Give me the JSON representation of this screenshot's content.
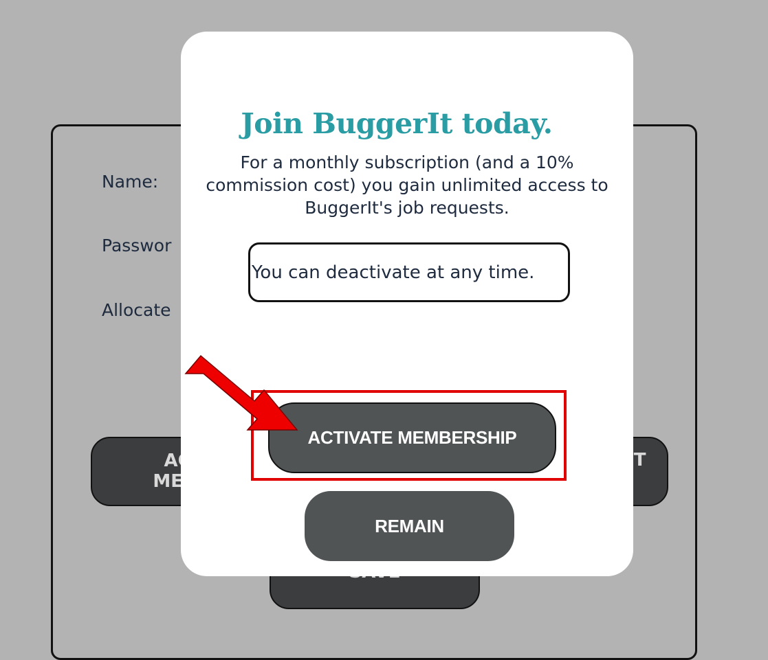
{
  "background": {
    "fields": {
      "name_label": "Name:",
      "password_label": "Passwor",
      "allocated_label": "Allocate"
    },
    "buttons": {
      "left_line1": "ACT",
      "left_line2": "MEMI",
      "right_fragment": "NT",
      "save_fragment": "SAVE"
    }
  },
  "modal": {
    "title": "Join BuggerIt today.",
    "description": "For a monthly subscription (and a 10% commission cost) you gain unlimited access to BuggerIt's job requests.",
    "note": "You can deactivate at any time.",
    "activate_label": "ACTIVATE MEMBERSHIP",
    "remain_label": "REMAIN"
  },
  "annotation": {
    "highlight_color": "#e10000",
    "arrow_color": "#ee0000"
  },
  "colors": {
    "title": "#2a9ca4",
    "button": "#505455",
    "backdrop": "#b3b3b3"
  }
}
